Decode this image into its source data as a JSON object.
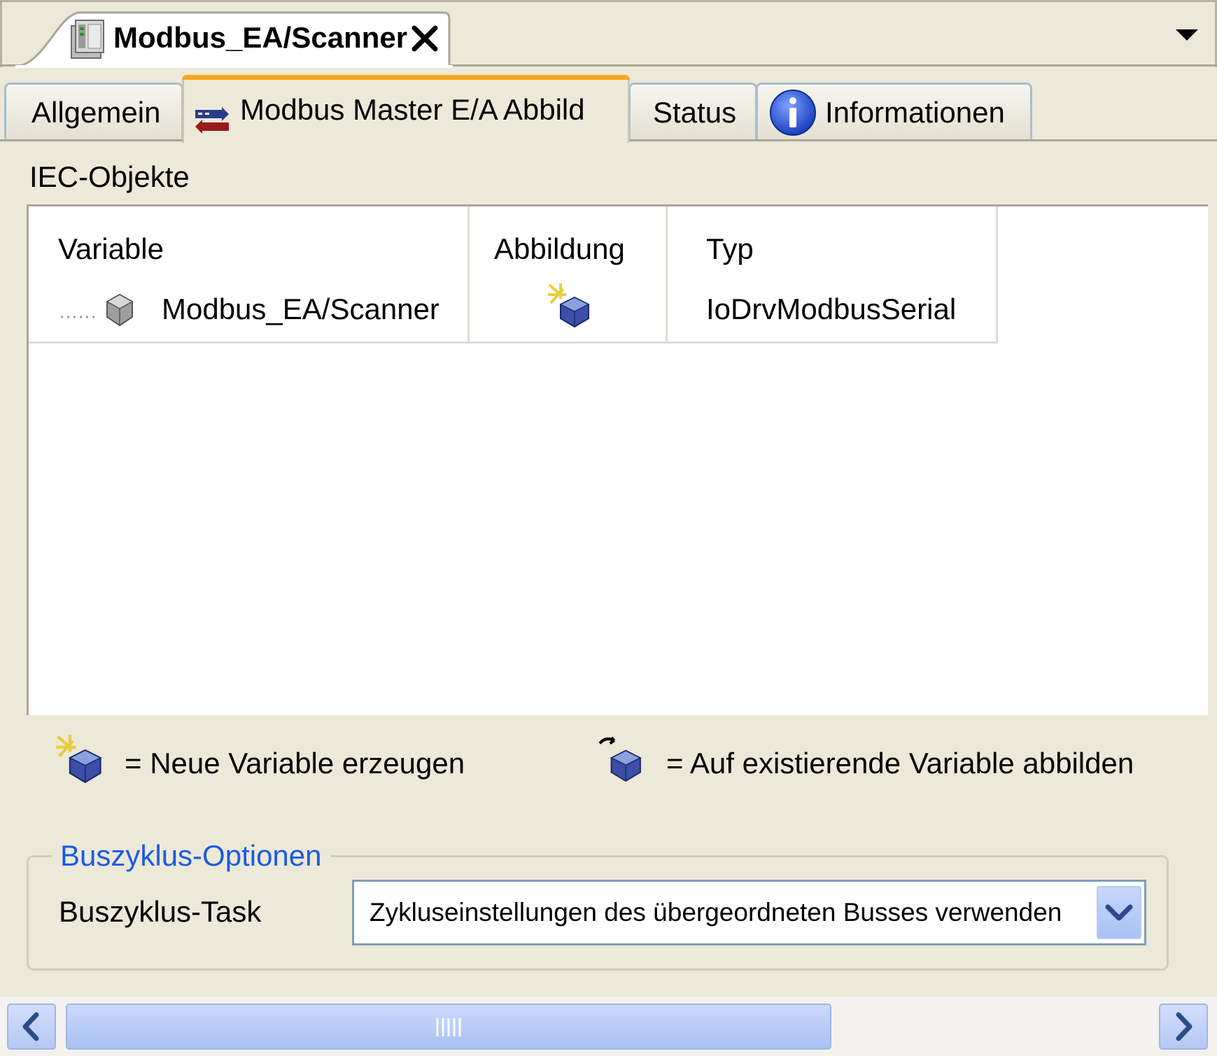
{
  "document_tab": {
    "title": "Modbus_EA/Scanner",
    "icon": "device-icon",
    "close_icon": "close-icon"
  },
  "tab_list_menu_icon": "chevron-down-icon",
  "tabs": [
    {
      "label": "Allgemein",
      "active": false
    },
    {
      "label": "Modbus Master E/A Abbild",
      "active": true,
      "icon": "io-mapping-icon"
    },
    {
      "label": "Status",
      "active": false
    },
    {
      "label": "Informationen",
      "active": false,
      "icon": "info-icon"
    }
  ],
  "iec": {
    "section_label": "IEC-Objekte",
    "columns": [
      "Variable",
      "Abbildung",
      "Typ"
    ],
    "rows": [
      {
        "variable": "Modbus_EA/Scanner",
        "mapping_icon": "new-variable-icon",
        "type": "IoDrvModbusSerial"
      }
    ]
  },
  "legend": {
    "new_variable": "= Neue Variable erzeugen",
    "existing_variable": "= Auf existierende Variable abbilden"
  },
  "bus_cycle": {
    "group_label": "Buszyklus-Optionen",
    "task_label": "Buszyklus-Task",
    "task_value": "Zykluseinstellungen des übergeordneten Busses verwenden"
  },
  "colors": {
    "active_tab_accent": "#f7a820",
    "group_label": "#1c5ae0",
    "scrollbar": "#b5c9f4"
  }
}
